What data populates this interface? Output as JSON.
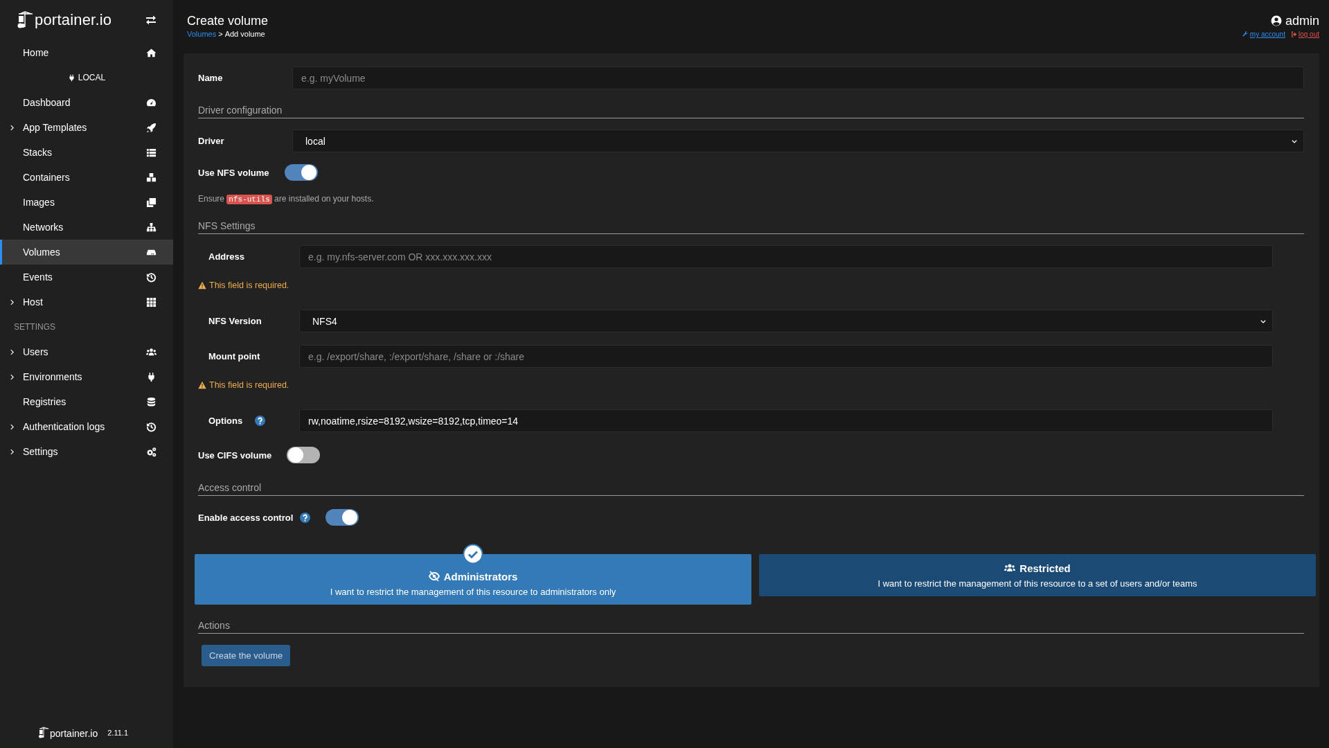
{
  "sidebar": {
    "logo": "portainer.io",
    "items": [
      {
        "kind": "item",
        "label": "Home",
        "expandable": false,
        "selected": false
      },
      {
        "kind": "endpoint",
        "label": "LOCAL"
      },
      {
        "kind": "item",
        "label": "Dashboard",
        "expandable": false,
        "selected": false
      },
      {
        "kind": "item",
        "label": "App Templates",
        "expandable": true,
        "selected": false
      },
      {
        "kind": "item",
        "label": "Stacks",
        "expandable": false,
        "selected": false
      },
      {
        "kind": "item",
        "label": "Containers",
        "expandable": false,
        "selected": false
      },
      {
        "kind": "item",
        "label": "Images",
        "expandable": false,
        "selected": false
      },
      {
        "kind": "item",
        "label": "Networks",
        "expandable": false,
        "selected": false
      },
      {
        "kind": "item",
        "label": "Volumes",
        "expandable": false,
        "selected": true
      },
      {
        "kind": "item",
        "label": "Events",
        "expandable": false,
        "selected": false
      },
      {
        "kind": "item",
        "label": "Host",
        "expandable": true,
        "selected": false
      },
      {
        "kind": "heading",
        "label": "SETTINGS"
      },
      {
        "kind": "item",
        "label": "Users",
        "expandable": true,
        "selected": false
      },
      {
        "kind": "item",
        "label": "Environments",
        "expandable": true,
        "selected": false
      },
      {
        "kind": "item",
        "label": "Registries",
        "expandable": false,
        "selected": false
      },
      {
        "kind": "item",
        "label": "Authentication logs",
        "expandable": true,
        "selected": false
      },
      {
        "kind": "item",
        "label": "Settings",
        "expandable": true,
        "selected": false
      }
    ],
    "footer": {
      "logo": "portainer.io",
      "version": "2.11.1"
    }
  },
  "header": {
    "title": "Create volume",
    "breadcrumb": {
      "link": "Volumes",
      "separator": ">",
      "current": "Add volume"
    },
    "user": {
      "name": "admin",
      "my_account": "my account",
      "log_out": "log out"
    }
  },
  "form": {
    "rows": [
      {
        "kind": "input",
        "label": "Name",
        "placeholder": "e.g. myVolume"
      },
      {
        "kind": "heading",
        "text": "Driver configuration"
      },
      {
        "kind": "select",
        "label": "Driver",
        "value": "local"
      },
      {
        "kind": "toggle",
        "label": "Use NFS volume",
        "on": true
      },
      {
        "kind": "note",
        "before": "Ensure",
        "code": "nfs-utils",
        "after": "are installed on your hosts."
      },
      {
        "kind": "heading",
        "text": "NFS Settings"
      },
      {
        "kind": "group",
        "rows": [
          {
            "kind": "input",
            "label": "Address",
            "placeholder": "e.g. my.nfs-server.com OR xxx.xxx.xxx.xxx"
          },
          {
            "kind": "warning",
            "text": "This field is required."
          },
          {
            "kind": "select",
            "label": "NFS Version",
            "value": "NFS4"
          },
          {
            "kind": "input",
            "label": "Mount point",
            "placeholder": "e.g. /export/share, :/export/share, /share or :/share"
          },
          {
            "kind": "warning",
            "text": "This field is required."
          },
          {
            "kind": "input",
            "label": "Options",
            "value": "rw,noatime,rsize=8192,wsize=8192,tcp,timeo=14",
            "help": true
          }
        ]
      },
      {
        "kind": "toggle",
        "label": "Use CIFS volume",
        "on": false
      },
      {
        "kind": "heading",
        "text": "Access control"
      },
      {
        "kind": "toggle",
        "label": "Enable access control",
        "on": true,
        "help": true
      },
      {
        "kind": "access",
        "options": [
          {
            "title": "Administrators",
            "description": "I want to restrict the management of this resource to administrators only",
            "selected": true
          },
          {
            "title": "Restricted",
            "description": "I want to restrict the management of this resource to a set of users and/or teams",
            "selected": false
          }
        ]
      },
      {
        "kind": "heading",
        "text": "Actions"
      },
      {
        "kind": "button",
        "label": "Create the volume"
      }
    ]
  }
}
